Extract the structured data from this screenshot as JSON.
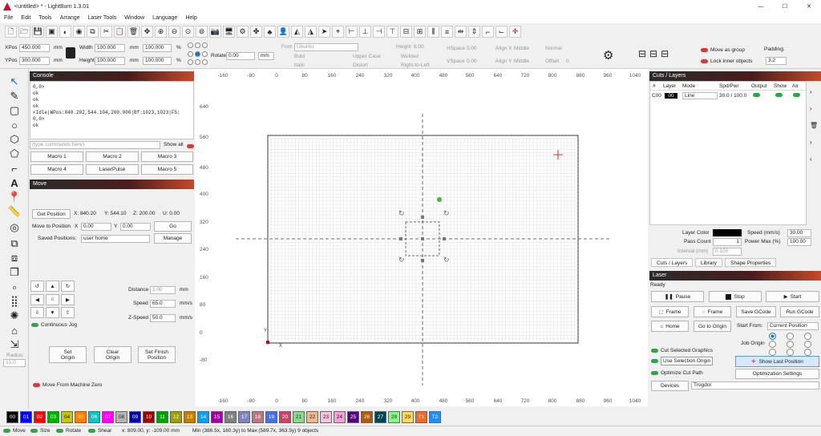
{
  "window": {
    "title": "<untitled> * - LightBurn 1.3.01",
    "min": "—",
    "max": "☐",
    "close": "✕"
  },
  "menu": [
    "File",
    "Edit",
    "Tools",
    "Arrange",
    "Laser Tools",
    "Window",
    "Language",
    "Help"
  ],
  "props": {
    "xpos_label": "XPos",
    "xpos": "450.000",
    "ypos_label": "YPos",
    "ypos": "300.000",
    "unit": "mm",
    "width_label": "Width",
    "width": "100.000",
    "height_label": "Height",
    "height": "100.000",
    "pct_w": "100.000",
    "pct_h": "100.000",
    "pct": "%",
    "rotate_label": "Rotate",
    "rotate": "0.00",
    "rot_unit": "mm",
    "font_label": "Font",
    "font": "Ubuntu",
    "height6_label": "Height",
    "height6": "6.00",
    "hspace_label": "HSpace",
    "hspace": "0.00",
    "vspace_label": "VSpace",
    "vspace": "0.00",
    "alignx_label": "Align X",
    "alignx": "Middle",
    "aligny_label": "Align Y",
    "aligny": "Middle",
    "normal": "Normal",
    "offset_label": "Offset",
    "offset": "0",
    "bold": "Bold",
    "italic": "Italic",
    "upper": "Upper Case",
    "distort": "Distort",
    "welded": "Welded",
    "rtl": "Right-to-Left",
    "move_group": "Move as group",
    "lock_inner": "Lock inner objects",
    "padding_label": "Padding:",
    "padding": "3.2"
  },
  "console": {
    "title": "Console",
    "lines": [
      "0,0>",
      "ok",
      "ok",
      "ok",
      "<Idle|WPos:840.202,544.104,200.000|Bf:1023,1023|FS:",
      "0,0>",
      "ok"
    ],
    "placeholder": "(type commands here)",
    "show_all": "Show all",
    "macros": [
      "Macro 1",
      "Macro 2",
      "Macro 3",
      "Macro 4",
      "LaserPulse",
      "Macro 5"
    ]
  },
  "move": {
    "title": "Move",
    "get_position": "Get Position",
    "x": "X: 840.20",
    "y": "Y: 544.10",
    "z": "Z: 200.00",
    "u": "U: 0.00",
    "move_to": "Move to Position",
    "mx_label": "X",
    "mx": "0.00",
    "my_label": "Y",
    "my": "0.00",
    "go": "Go",
    "saved_label": "Saved Positions:",
    "saved": "user home",
    "manage": "Manage",
    "distance_label": "Distance",
    "distance": "1.00",
    "speed_label": "Speed",
    "speed": "65.0",
    "zspeed_label": "Z-Speed",
    "zspeed": "50.0",
    "mm": "mm",
    "mms": "mm/s",
    "continuous": "Continuous Jog",
    "set_origin": [
      "Set",
      "Origin"
    ],
    "clear_origin": [
      "Clear",
      "Origin"
    ],
    "set_finish": [
      "Set Finish",
      "Position"
    ],
    "from_zero": "Move From Machine Zero"
  },
  "radius": {
    "label": "Radius:",
    "value": "10.0"
  },
  "ruler": {
    "top": [
      "-160",
      "-80",
      "0",
      "80",
      "160",
      "240",
      "320",
      "400",
      "480",
      "560",
      "640",
      "720",
      "800",
      "880",
      "960",
      "1040"
    ],
    "left": [
      "640",
      "560",
      "480",
      "400",
      "320",
      "240",
      "160",
      "80",
      "0",
      "-80"
    ]
  },
  "cuts": {
    "title": "Cuts / Layers",
    "headers": [
      "#",
      "Layer",
      "Mode",
      "Spd/Pwr",
      "Output",
      "Show",
      "Air"
    ],
    "row": {
      "id": "C00",
      "layer": "00",
      "mode": "Line",
      "spdpwr": "30.0 / 100.0"
    },
    "layer_color": "Layer Color",
    "speed_label": "Speed (mm/s)",
    "speed": "30.00",
    "pass_label": "Pass Count",
    "pass": "1",
    "power_label": "Power Max (%)",
    "power": "100.00",
    "interval_label": "Interval (mm)",
    "interval": "0.100",
    "tabs": [
      "Cuts / Layers",
      "Library",
      "Shape Properties"
    ]
  },
  "laser": {
    "title": "Laser",
    "status": "Ready",
    "pause": "Pause",
    "stop": "Stop",
    "start": "Start",
    "frame1": "Frame",
    "frame2": "Frame",
    "save_gcode": "Save GCode",
    "run_gcode": "Run GCode",
    "home": "Home",
    "go_origin": "Go to Origin",
    "start_from_label": "Start From:",
    "start_from": "Current Position",
    "job_origin": "Job Origin",
    "cut_selected": "Cut Selected Graphics",
    "use_selection": "Use Selection Origin",
    "show_last": "Show Last Position",
    "optimize": "Optimize Cut Path",
    "opt_settings": "Optimization Settings",
    "devices": "Devices",
    "device": "Trogdor"
  },
  "palette": [
    {
      "l": "00",
      "c": "#000000"
    },
    {
      "l": "01",
      "c": "#0000ff"
    },
    {
      "l": "02",
      "c": "#ff0000"
    },
    {
      "l": "03",
      "c": "#00b000"
    },
    {
      "l": "04",
      "c": "#c8c800"
    },
    {
      "l": "05",
      "c": "#ff8000"
    },
    {
      "l": "06",
      "c": "#00c8c8"
    },
    {
      "l": "07",
      "c": "#ff00ff"
    },
    {
      "l": "08",
      "c": "#b4b4b4"
    },
    {
      "l": "09",
      "c": "#0000a0"
    },
    {
      "l": "10",
      "c": "#a00000"
    },
    {
      "l": "11",
      "c": "#00a000"
    },
    {
      "l": "12",
      "c": "#a0a000"
    },
    {
      "l": "13",
      "c": "#c08000"
    },
    {
      "l": "14",
      "c": "#00a0ff"
    },
    {
      "l": "15",
      "c": "#a000a0"
    },
    {
      "l": "16",
      "c": "#808080"
    },
    {
      "l": "17",
      "c": "#7d87b9"
    },
    {
      "l": "18",
      "c": "#bb7784"
    },
    {
      "l": "19",
      "c": "#4a6fe3"
    },
    {
      "l": "20",
      "c": "#d33f6a"
    },
    {
      "l": "21",
      "c": "#8cd78c"
    },
    {
      "l": "22",
      "c": "#f0b98d"
    },
    {
      "l": "23",
      "c": "#f6c4e1"
    },
    {
      "l": "24",
      "c": "#fa9ed4"
    },
    {
      "l": "25",
      "c": "#500a78"
    },
    {
      "l": "26",
      "c": "#b45a00"
    },
    {
      "l": "27",
      "c": "#004754"
    },
    {
      "l": "28",
      "c": "#86fa88"
    },
    {
      "l": "29",
      "c": "#ffdb66"
    },
    {
      "l": "T1",
      "c": "#f36926"
    },
    {
      "l": "T2",
      "c": "#1e90ff"
    }
  ],
  "statusbar": {
    "move": "Move",
    "size": "Size",
    "rotate": "Rotate",
    "shear": "Shear",
    "coords": "x: 809.00, y: -109.00 mm",
    "range": "Min (386.5x, 160.3y) to Max (589.7x, 363.5y)  9 objects"
  }
}
